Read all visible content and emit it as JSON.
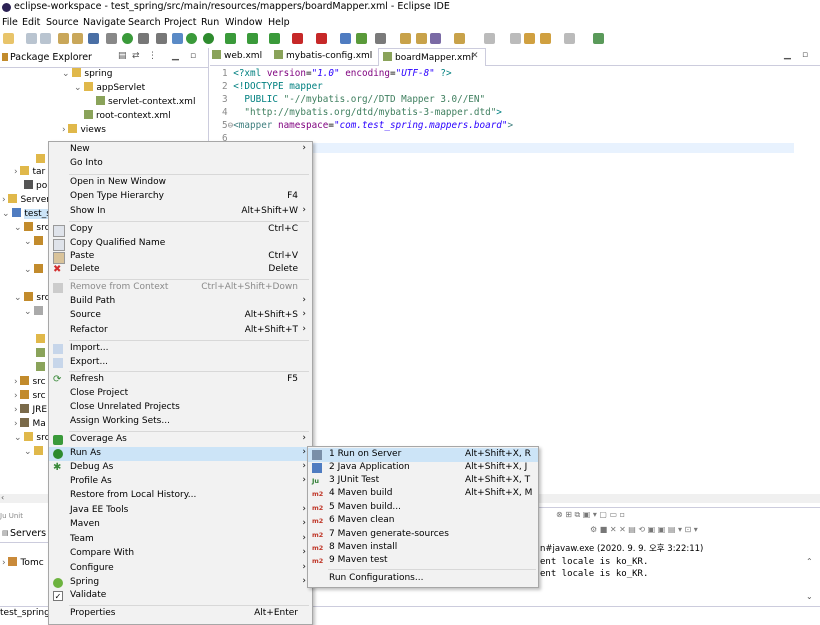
{
  "window": {
    "title": "eclipse-workspace - test_spring/src/main/resources/mappers/boardMapper.xml - Eclipse IDE"
  },
  "menubar": [
    "File",
    "Edit",
    "Source",
    "Navigate",
    "Search",
    "Project",
    "Run",
    "Window",
    "Help"
  ],
  "explorer": {
    "title": "Package Explorer",
    "items": [
      {
        "label": "spring"
      },
      {
        "label": "appServlet"
      },
      {
        "label": "servlet-context.xml"
      },
      {
        "label": "root-context.xml"
      },
      {
        "label": "views"
      },
      {
        "label": "tar"
      },
      {
        "label": "po"
      },
      {
        "label": "Server"
      },
      {
        "label": "test_sp"
      },
      {
        "label": "src"
      },
      {
        "label": "src"
      },
      {
        "label": "src"
      },
      {
        "label": "src"
      },
      {
        "label": "JRE"
      },
      {
        "label": "Ma"
      },
      {
        "label": "src"
      }
    ],
    "servers_tab": "Servers",
    "tomcat": "Tomc",
    "status_project": "test_spring"
  },
  "editor": {
    "tabs": [
      "web.xml",
      "mybatis-config.xml",
      "boardMapper.xml"
    ],
    "lines": {
      "l1_num": "1",
      "l1_a": "<?xml ",
      "l1_b": "version",
      "l1_c": "=",
      "l1_d": "\"1.0\"",
      "l1_e": " encoding",
      "l1_f": "=",
      "l1_g": "\"UTF-8\"",
      "l1_h": " ?>",
      "l2_num": "2",
      "l2_a": "<!DOCTYPE mapper",
      "l3_num": "3",
      "l3_a": "  PUBLIC ",
      "l3_b": "\"-//mybatis.org//DTD Mapper 3.0//EN\"",
      "l4_num": "4",
      "l4_a": "  ",
      "l4_b": "\"http://mybatis.org/dtd/mybatis-3-mapper.dtd\"",
      "l4_c": ">",
      "l5_num": "5⊖",
      "l5_a": "<mapper ",
      "l5_b": "namespace",
      "l5_c": "=",
      "l5_d": "\"com.test_spring.mappers.board\"",
      "l5_e": ">",
      "l6_num": "6"
    }
  },
  "console": {
    "header": "n#javaw.exe  (2020. 9. 9. 오후 3:22:11)",
    "line1": "ent locale is ko_KR.",
    "line2": "ent locale is ko_KR."
  },
  "context_menu": {
    "new": "New",
    "go_into": "Go Into",
    "open_new_window": "Open in New Window",
    "open_type_hierarchy": "Open Type Hierarchy",
    "open_type_hierarchy_sc": "F4",
    "show_in": "Show In",
    "show_in_sc": "Alt+Shift+W",
    "copy": "Copy",
    "copy_sc": "Ctrl+C",
    "copy_qualified": "Copy Qualified Name",
    "paste": "Paste",
    "paste_sc": "Ctrl+V",
    "delete": "Delete",
    "delete_sc": "Delete",
    "remove_context": "Remove from Context",
    "remove_context_sc": "Ctrl+Alt+Shift+Down",
    "build_path": "Build Path",
    "source": "Source",
    "source_sc": "Alt+Shift+S",
    "refactor": "Refactor",
    "refactor_sc": "Alt+Shift+T",
    "import": "Import...",
    "export": "Export...",
    "refresh": "Refresh",
    "refresh_sc": "F5",
    "close_project": "Close Project",
    "close_unrelated": "Close Unrelated Projects",
    "assign_working_sets": "Assign Working Sets...",
    "coverage_as": "Coverage As",
    "run_as": "Run As",
    "debug_as": "Debug As",
    "profile_as": "Profile As",
    "restore_local_history": "Restore from Local History...",
    "java_ee_tools": "Java EE Tools",
    "maven": "Maven",
    "team": "Team",
    "compare_with": "Compare With",
    "configure": "Configure",
    "spring": "Spring",
    "validate": "Validate",
    "properties": "Properties",
    "properties_sc": "Alt+Enter"
  },
  "run_as_submenu": {
    "items": [
      {
        "label": "1 Run on Server",
        "shortcut": "Alt+Shift+X, R",
        "icon": "server-icon"
      },
      {
        "label": "2 Java Application",
        "shortcut": "Alt+Shift+X, J",
        "icon": "java-app-icon"
      },
      {
        "label": "3 JUnit Test",
        "shortcut": "Alt+Shift+X, T",
        "icon": "junit-icon",
        "badge": "Ju"
      },
      {
        "label": "4 Maven build",
        "shortcut": "Alt+Shift+X, M",
        "icon": "maven-icon",
        "badge": "m2"
      },
      {
        "label": "5 Maven build...",
        "shortcut": "",
        "icon": "maven-icon",
        "badge": "m2"
      },
      {
        "label": "6 Maven clean",
        "shortcut": "",
        "icon": "maven-icon",
        "badge": "m2"
      },
      {
        "label": "7 Maven generate-sources",
        "shortcut": "",
        "icon": "maven-icon",
        "badge": "m2"
      },
      {
        "label": "8 Maven install",
        "shortcut": "",
        "icon": "maven-icon",
        "badge": "m2"
      },
      {
        "label": "9 Maven test",
        "shortcut": "",
        "icon": "maven-icon",
        "badge": "m2"
      }
    ],
    "run_configurations": "Run Configurations..."
  },
  "colors": {
    "highlight": "#cce4f7",
    "menu_bg": "#f2f2f2"
  }
}
